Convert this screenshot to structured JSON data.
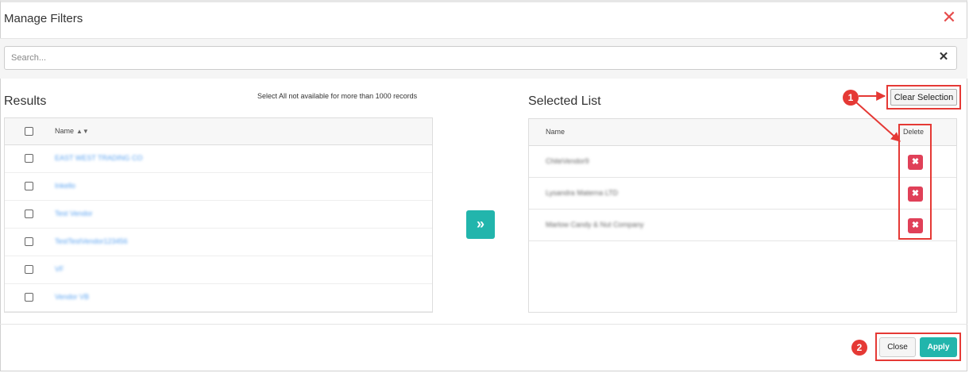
{
  "dialog": {
    "title": "Manage Filters",
    "close_icon": "close-icon"
  },
  "search": {
    "placeholder": "Search...",
    "value": "",
    "clear_icon": "close-icon"
  },
  "results": {
    "title": "Results",
    "note": "Select All not available for more than 1000 records",
    "column_name": "Name",
    "sort_icon": "sort-icon",
    "rows": [
      {
        "label": "EAST WEST TRADING CO"
      },
      {
        "label": "Inkello"
      },
      {
        "label": "Test Vendor"
      },
      {
        "label": "TestTestVendor123456"
      },
      {
        "label": "VF"
      },
      {
        "label": "Vendor VB"
      }
    ]
  },
  "transfer_button": {
    "icon": "double-chevron-right-icon",
    "glyph": "»"
  },
  "selected": {
    "title": "Selected List",
    "clear_label": "Clear Selection",
    "column_name": "Name",
    "column_delete": "Delete",
    "delete_glyph": "✖",
    "rows": [
      {
        "label": "ChiteVendor9"
      },
      {
        "label": "Lysandra Materna LTD"
      },
      {
        "label": "Marlow Candy & Nut Company"
      }
    ]
  },
  "annotations": {
    "marker_1": "1",
    "marker_2": "2",
    "highlight_color": "#e53935"
  },
  "footer": {
    "close_label": "Close",
    "apply_label": "Apply"
  },
  "colors": {
    "accent_teal": "#22b5ac",
    "delete_red": "#e04058",
    "link_blue": "#5aa2f0"
  }
}
